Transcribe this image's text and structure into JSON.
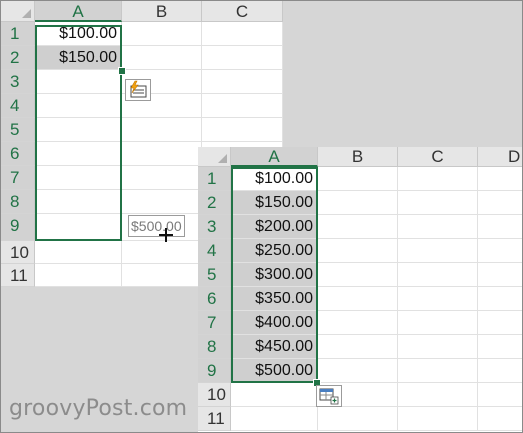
{
  "sheet_top": {
    "columns": [
      "A",
      "B",
      "C"
    ],
    "rows": [
      "1",
      "2",
      "3",
      "4",
      "5",
      "6",
      "7",
      "8",
      "9",
      "10",
      "11"
    ],
    "values": [
      "$100.00",
      "$150.00"
    ],
    "fill_preview_tooltip": "$500.00",
    "flash_fill_icon": "flash-fill-icon",
    "selected_column": "A"
  },
  "sheet_bottom": {
    "columns": [
      "A",
      "B",
      "C",
      "D"
    ],
    "rows": [
      "1",
      "2",
      "3",
      "4",
      "5",
      "6",
      "7",
      "8",
      "9",
      "10",
      "11"
    ],
    "values": [
      "$100.00",
      "$150.00",
      "$200.00",
      "$250.00",
      "$300.00",
      "$350.00",
      "$400.00",
      "$450.00",
      "$500.00"
    ],
    "autofill_options_icon": "autofill-options-icon",
    "selected_column": "A"
  },
  "watermark": "groovyPost.com",
  "colors": {
    "selection_border": "#217346",
    "selected_fill": "#cfcfcf",
    "header_bg": "#e6e6e6",
    "gridline": "#e1e1e1"
  }
}
